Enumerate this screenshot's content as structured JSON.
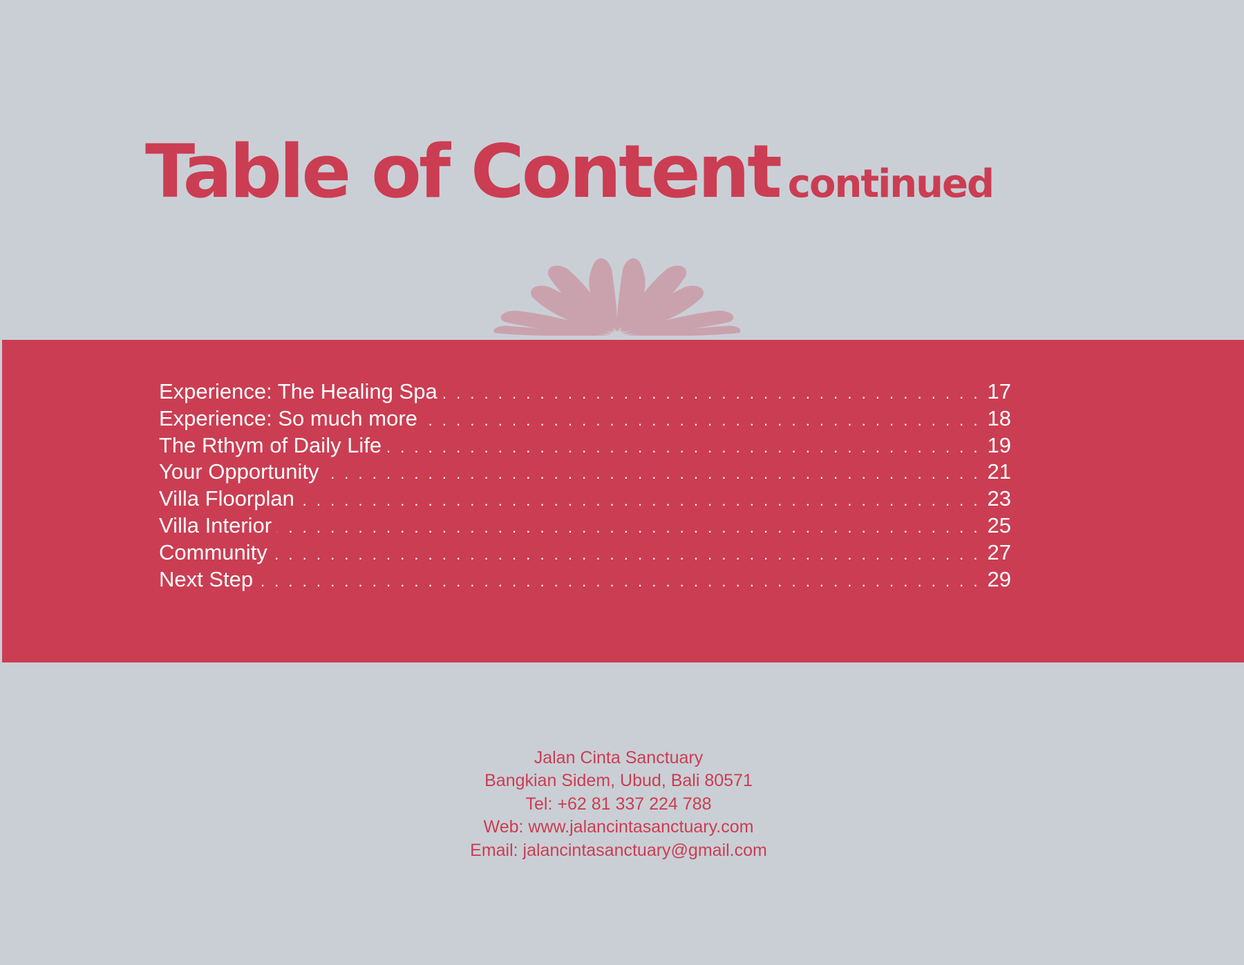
{
  "heading": {
    "title": "Table of Content",
    "subtitle": "continued"
  },
  "toc": [
    {
      "label": "Experience: The Healing Spa",
      "page": "17"
    },
    {
      "label": "Experience: So much more",
      "page": "18"
    },
    {
      "label": "The Rthym of Daily Life",
      "page": "19"
    },
    {
      "label": "Your Opportunity",
      "page": "21"
    },
    {
      "label": "Villa Floorplan",
      "page": "23"
    },
    {
      "label": "Villa Interior",
      "page": "25"
    },
    {
      "label": "Community",
      "page": "27"
    },
    {
      "label": "Next Step",
      "page": "29"
    }
  ],
  "contact": {
    "name": "Jalan Cinta Sanctuary",
    "address": "Bangkian Sidem, Ubud, Bali 80571",
    "tel": "Tel: +62 81 337 224 788",
    "web": "Web: www.jalancintasanctuary.com",
    "email": "Email: jalancintasanctuary@gmail.com"
  },
  "colors": {
    "accent": "#cb3d52",
    "background": "#cacfd6",
    "text_on_accent": "#ffffff"
  },
  "icons": {
    "ornament": "lotus-icon"
  }
}
